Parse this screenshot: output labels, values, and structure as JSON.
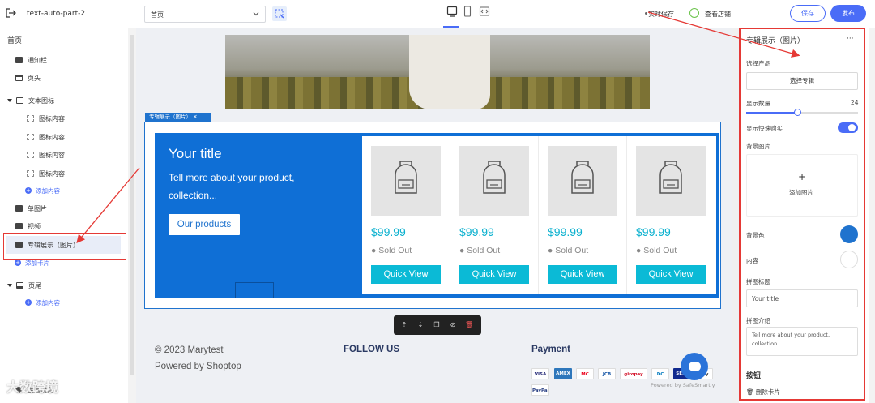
{
  "topbar": {
    "app_title": "text-auto-part-2",
    "page_select": "首页",
    "realtime_save": "实时保存",
    "view_store": "查看店铺",
    "save_label": "保存",
    "publish_label": "发布"
  },
  "sidebar": {
    "home": "首页",
    "items": [
      {
        "label": "通知栏"
      },
      {
        "label": "页头"
      },
      {
        "label": "文本图标"
      },
      {
        "label": "图标内容"
      },
      {
        "label": "图标内容"
      },
      {
        "label": "图标内容"
      },
      {
        "label": "图标内容"
      },
      {
        "label": "添加内容"
      },
      {
        "label": "单图片"
      },
      {
        "label": "视频"
      },
      {
        "label": "专辑展示（图片）"
      },
      {
        "label": "添加卡片"
      },
      {
        "label": "页尾"
      },
      {
        "label": "添加内容"
      }
    ],
    "settings": "主题设置"
  },
  "canvas": {
    "section_tag": "专辑展示（图片）",
    "section_tag_close": "✕",
    "panel": {
      "title": "Your title",
      "desc": "Tell more about your product, collection...",
      "button": "Our products"
    },
    "products": [
      {
        "price": "$99.99",
        "status": "Sold Out",
        "button": "Quick View"
      },
      {
        "price": "$99.99",
        "status": "Sold Out",
        "button": "Quick View"
      },
      {
        "price": "$99.99",
        "status": "Sold Out",
        "button": "Quick View"
      },
      {
        "price": "$99.99",
        "status": "Sold Out",
        "button": "Quick View"
      }
    ],
    "footer": {
      "copyright": "© 2023 Marytest",
      "powered": "Powered by Shoptop",
      "follow": "FOLLOW US",
      "payment": "Payment",
      "safe": "Powered by SafeSmartly",
      "pay_methods": [
        "VISA",
        "AMEX",
        "MC",
        "JCB",
        "giropay",
        "DC",
        "SEPA",
        "Pay",
        "PayPal"
      ]
    }
  },
  "rpanel": {
    "title": "专辑展示（图片）",
    "more": "···",
    "select_product_label": "选择产品",
    "select_album": "选择专辑",
    "count_label": "显示数量",
    "count_value": 24,
    "quick_buy_label": "显示快速购买",
    "quick_buy_on": true,
    "bg_image_label": "背景图片",
    "add_image_plus": "+",
    "add_image": "添加图片",
    "bg_color_label": "背景色",
    "bg_color": "#1f73ce",
    "content_label": "内容",
    "content_color": "#ffffff",
    "collage_title_label": "拼图标题",
    "collage_title_value": "Your title",
    "collage_desc_label": "拼图介绍",
    "collage_desc_value": "Tell more about your product, collection...",
    "button_heading": "按钮",
    "delete_card": "删除卡片"
  },
  "watermark": "大数跨境",
  "colors": {
    "accent": "#4a6cf7",
    "section_blue": "#1f73ce",
    "price_cyan": "#0bb1cf",
    "annotation_red": "#e53935"
  }
}
